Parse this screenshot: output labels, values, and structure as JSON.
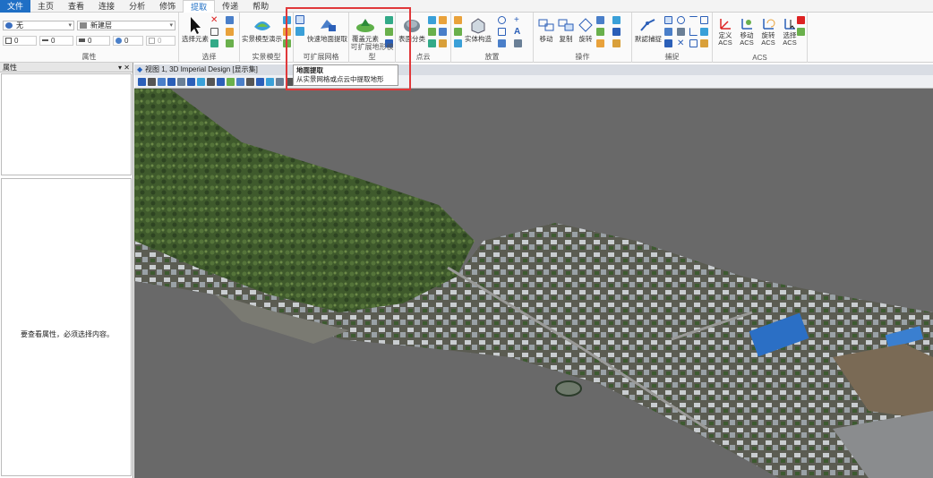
{
  "tabs": [
    "文件",
    "主页",
    "查看",
    "连接",
    "分析",
    "修饰",
    "提取",
    "传递",
    "帮助"
  ],
  "active_tab": "提取",
  "attributes_group": {
    "label": "属性",
    "level_combo": "无",
    "model_combo": "新建层",
    "row2": [
      "0",
      "0",
      "0",
      "0",
      "0"
    ]
  },
  "groups": {
    "select": {
      "label": "选择",
      "button": "选择元素"
    },
    "reality": {
      "label": "实景模型",
      "button": "实景模型演示"
    },
    "scalable_mesh": {
      "label": "可扩展网格",
      "button": "快速地面提取"
    },
    "scalable_terrain": {
      "label": "可扩展地形模型",
      "button": "覆盖元素"
    },
    "pointcloud": {
      "label": "点云",
      "button": "表面分类"
    },
    "placement": {
      "label": "放置",
      "button": "实体构造"
    },
    "operation": {
      "label": "操作",
      "buttons": [
        "移动",
        "复制",
        "旋转"
      ]
    },
    "snap": {
      "label": "捕捉",
      "button": "默認捕捉"
    },
    "acs": {
      "label": "ACS",
      "buttons": [
        "定义 ACS",
        "移动 ACS",
        "旋转 ACS",
        "选择 ACS"
      ]
    }
  },
  "tooltip": {
    "title": "地面提取",
    "desc": "从实景网格或点云中提取地形"
  },
  "left_panel": {
    "title": "属性",
    "controls": "▾ ✕",
    "message": "要查看属性，必须选择内容。"
  },
  "view": {
    "title": "视图 1, 3D Imperial Design [显示集]"
  },
  "colors": {
    "accent": "#1f6fc5",
    "highlight": "#e0383a",
    "background": "#6a6a6a"
  }
}
